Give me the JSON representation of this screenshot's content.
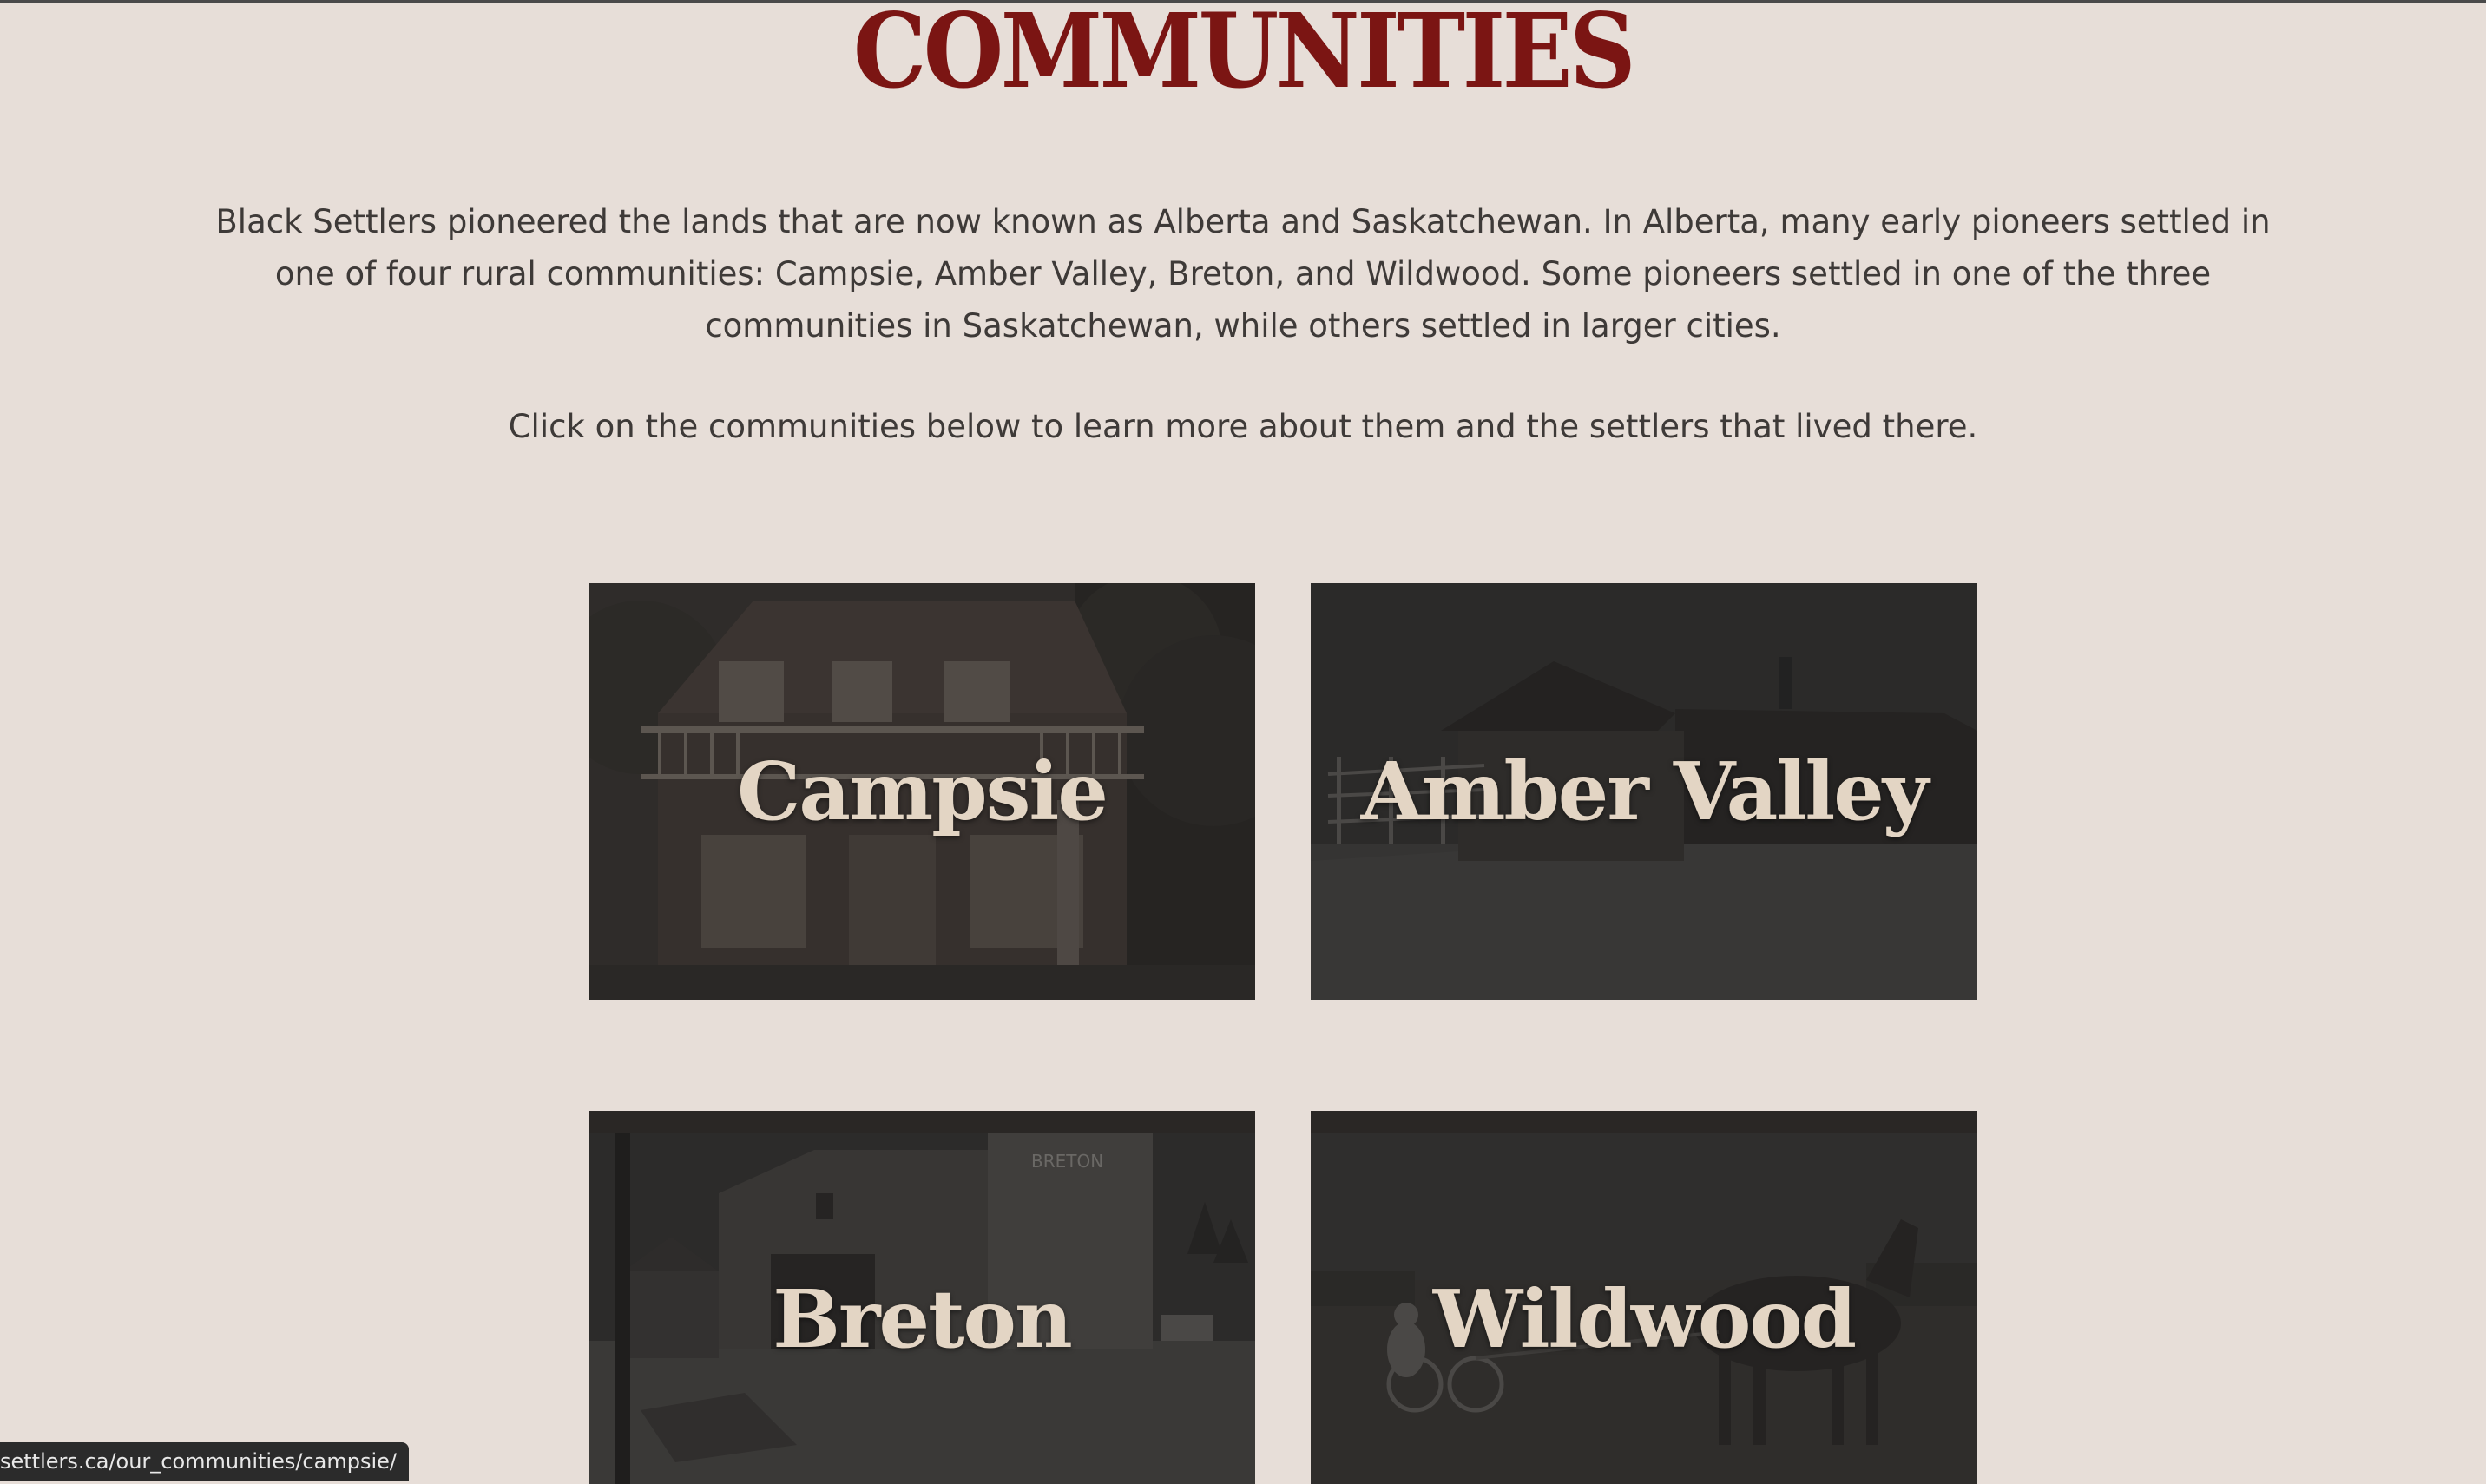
{
  "page": {
    "title": "COMMUNITIES",
    "intro": "Black Settlers pioneered the lands that are now known as Alberta and Saskatchewan. In Alberta, many early pioneers settled in one of four rural communities: Campsie, Amber Valley, Breton, and Wildwood. Some pioneers settled in one of the three communities in Saskatchewan, while others settled in larger cities.",
    "instruction": "Click on the communities below to learn more about them and the settlers that lived there."
  },
  "communities": [
    {
      "name": "Campsie"
    },
    {
      "name": "Amber Valley"
    },
    {
      "name": "Breton",
      "sign_text": "BRETON"
    },
    {
      "name": "Wildwood"
    }
  ],
  "status_bar": {
    "url": "settlers.ca/our_communities/campsie/"
  },
  "colors": {
    "background": "#e7ded8",
    "title": "#7b1513",
    "body_text": "#3e3a38",
    "card_label": "#e3d5c4"
  }
}
